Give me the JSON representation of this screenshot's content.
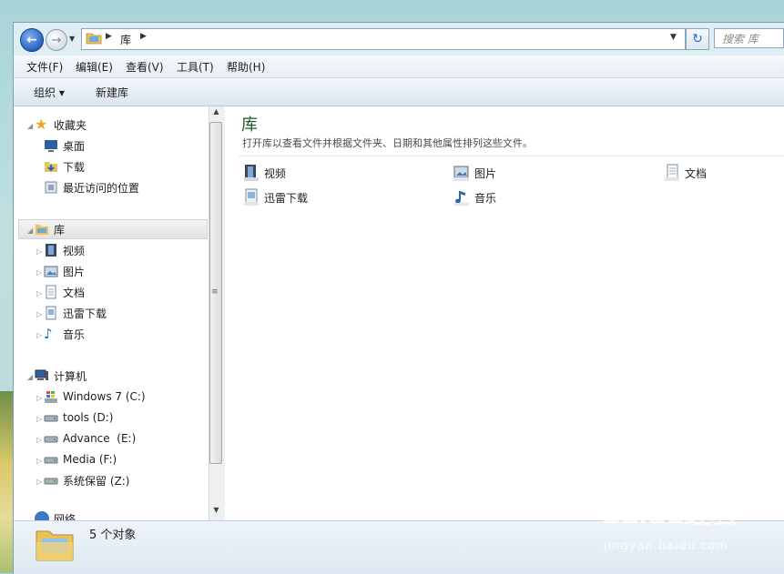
{
  "address": {
    "path": [
      "库"
    ],
    "search_placeholder": "搜索 库"
  },
  "menu": [
    "文件(F)",
    "编辑(E)",
    "查看(V)",
    "工具(T)",
    "帮助(H)"
  ],
  "commands": {
    "organize": "组织 ▾",
    "new_library": "新建库"
  },
  "nav": {
    "favorites": {
      "label": "收藏夹",
      "items": [
        "桌面",
        "下载",
        "最近访问的位置"
      ]
    },
    "libraries": {
      "label": "库",
      "items": [
        "视频",
        "图片",
        "文档",
        "迅雷下载",
        "音乐"
      ]
    },
    "computer": {
      "label": "计算机",
      "items": [
        "Windows 7 (C:)",
        "tools (D:)",
        "Advance  (E:)",
        "Media (F:)",
        "系统保留 (Z:)"
      ]
    },
    "network_partial": "网络"
  },
  "content": {
    "title": "库",
    "subtitle": "打开库以查看文件并根据文件夹、日期和其他属性排列这些文件。",
    "libraries": [
      "视频",
      "图片",
      "文档",
      "迅雷下载",
      "音乐"
    ]
  },
  "status": {
    "count_text": "5 个对象"
  },
  "watermark": {
    "brand": "Baidu经验",
    "url": "jingyan.baidu.com"
  },
  "colors": {
    "title_green": "#1e5a2e",
    "accent_blue": "#2a63c4"
  }
}
